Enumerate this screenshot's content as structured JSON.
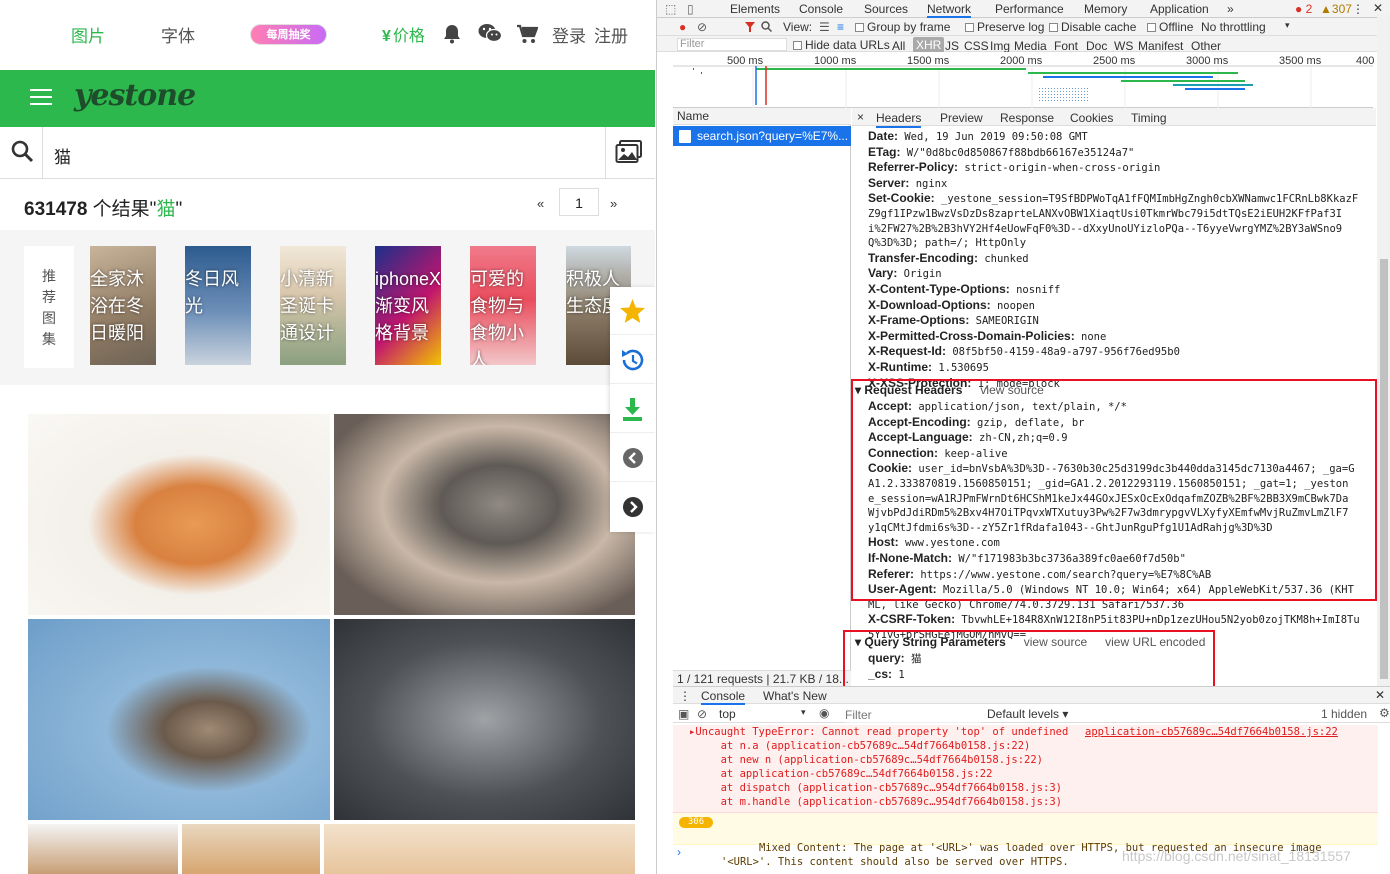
{
  "site": {
    "nav": {
      "pictures": "图片",
      "fonts": "字体",
      "weekly": "每周抽奖",
      "price": "价格",
      "login": "登录",
      "register": "注册"
    },
    "logo": "yestone",
    "search": {
      "query": "猫"
    },
    "results": {
      "count": "631478",
      "suffix": " 个结果\"",
      "keyword": "猫",
      "close": "\""
    },
    "pager": {
      "prev": "«",
      "page": "1",
      "next": "»"
    },
    "recommend": {
      "tag": [
        "推",
        "荐",
        "图",
        "集"
      ]
    },
    "cards": [
      {
        "lines": [
          "全家沐",
          "浴在冬",
          "日暖阳"
        ]
      },
      {
        "lines": [
          "冬日风",
          "光"
        ]
      },
      {
        "lines": [
          "小清新",
          "圣诞卡",
          "通设计"
        ]
      },
      {
        "lines": [
          "iphoneX",
          "渐变风",
          "格背景"
        ]
      },
      {
        "lines": [
          "可爱的",
          "食物与",
          "食物小",
          "人"
        ]
      },
      {
        "lines": [
          "积极人",
          "生态度"
        ]
      }
    ]
  },
  "devtools": {
    "tabs": [
      "Elements",
      "Console",
      "Sources",
      "Network",
      "Performance",
      "Memory",
      "Application",
      "»"
    ],
    "status": {
      "errors": "2",
      "warnings": "307"
    },
    "toolbar": {
      "view": "View:",
      "group": "Group by frame",
      "preserve": "Preserve log",
      "cache": "Disable cache",
      "offline": "Offline",
      "throttle": "No throttling"
    },
    "filter": {
      "placeholder": "Filter",
      "hide": "Hide data URLs",
      "types": [
        "All",
        "XHR",
        "JS",
        "CSS",
        "Img",
        "Media",
        "Font",
        "Doc",
        "WS",
        "Manifest",
        "Other"
      ]
    },
    "ticks": [
      "500 ms",
      "1000 ms",
      "1500 ms",
      "2000 ms",
      "2500 ms",
      "3000 ms",
      "3500 ms",
      "400"
    ],
    "name_header": "Name",
    "request": "search.json?query=%E7%...",
    "footer": "1 / 121 requests  |  21.7 KB / 18...",
    "detail_tabs": [
      "×",
      "Headers",
      "Preview",
      "Response",
      "Cookies",
      "Timing"
    ],
    "response_headers": [
      {
        "k": "Date:",
        "v": " Wed, 19 Jun 2019 09:50:08 GMT"
      },
      {
        "k": "ETag:",
        "v": " W/\"0d8bc0d850867f88bdb66167e35124a7\""
      },
      {
        "k": "Referrer-Policy:",
        "v": " strict-origin-when-cross-origin"
      },
      {
        "k": "Server:",
        "v": " nginx"
      },
      {
        "k": "Set-Cookie:",
        "v": " _yestone_session=T9SfBDPWoTqA1fFQMImbHgZngh0cbXWNamwc1FCRnLb8KkazF"
      },
      {
        "k": "",
        "v": "Z9gf1IPzw1BwzVsDzDs8zaprteLANXvOBW1XiaqtUsi0TkmrWbc79i5dtTQsE2iEUH2KFfPaf3I"
      },
      {
        "k": "",
        "v": "i%2FW27%2B%2B3hVY2Hf4eUowFqF0%3D--dXxyUnoUYizloPQa--T6yyeVwrgYMZ%2BY3aWSno9"
      },
      {
        "k": "",
        "v": "Q%3D%3D; path=/; HttpOnly"
      },
      {
        "k": "Transfer-Encoding:",
        "v": " chunked"
      },
      {
        "k": "Vary:",
        "v": " Origin"
      },
      {
        "k": "X-Content-Type-Options:",
        "v": " nosniff"
      },
      {
        "k": "X-Download-Options:",
        "v": " noopen"
      },
      {
        "k": "X-Frame-Options:",
        "v": " SAMEORIGIN"
      },
      {
        "k": "X-Permitted-Cross-Domain-Policies:",
        "v": " none"
      },
      {
        "k": "X-Request-Id:",
        "v": " 08f5bf50-4159-48a9-a797-956f76ed95b0"
      },
      {
        "k": "X-Runtime:",
        "v": " 1.530695"
      },
      {
        "k": "X-XSS-Protection:",
        "v": " 1; mode=block"
      }
    ],
    "request_headers_title": "Request Headers",
    "view_source": "view source",
    "request_headers": [
      {
        "k": "Accept:",
        "v": " application/json, text/plain, */*"
      },
      {
        "k": "Accept-Encoding:",
        "v": " gzip, deflate, br"
      },
      {
        "k": "Accept-Language:",
        "v": " zh-CN,zh;q=0.9"
      },
      {
        "k": "Connection:",
        "v": " keep-alive"
      },
      {
        "k": "Cookie:",
        "v": " user_id=bnVsbA%3D%3D--7630b30c25d3199dc3b440dda3145dc7130a4467; _ga=G"
      },
      {
        "k": "",
        "v": "A1.2.333870819.1560850151; _gid=GA1.2.2012293119.1560850151; _gat=1; _yeston"
      },
      {
        "k": "",
        "v": "e_session=wA1RJPmFWrnDt6HCShM1keJx44GOxJESxOcExOdqafmZOZB%2BF%2BB3X9mCBwk7Da"
      },
      {
        "k": "",
        "v": "WjvbPdJdiRDm5%2Bxv4H7OiTPqvxWTXutuy3Pw%2F7w3dmrypgvVLXyfyXEmfwMvjRuZmvLmZlF7"
      },
      {
        "k": "",
        "v": "y1qCMtJfdmi6s%3D--zY5Zr1fRdafa1043--GhtJunRguPfg1U1AdRahjg%3D%3D"
      },
      {
        "k": "Host:",
        "v": " www.yestone.com"
      },
      {
        "k": "If-None-Match:",
        "v": " W/\"f171983b3bc3736a389fc0ae60f7d50b\""
      },
      {
        "k": "Referer:",
        "v": " https://www.yestone.com/search?query=%E7%8C%AB"
      },
      {
        "k": "User-Agent:",
        "v": " Mozilla/5.0 (Windows NT 10.0; Win64; x64) AppleWebKit/537.36 (KHT"
      },
      {
        "k": "",
        "v": "ML, like Gecko) Chrome/74.0.3729.131 Safari/537.36"
      },
      {
        "k": "X-CSRF-Token:",
        "v": " TbvwhLE+184R8XnW12I8nP5it83PU+nDp1zezUHou5N2yob0zojTKM8h+ImI8Tu"
      },
      {
        "k": "",
        "v": "5Y1vG+prSHGEejMGOM/nMvQ=="
      }
    ],
    "query_title": "Query String Parameters",
    "view_url": "view URL encoded",
    "query_params": [
      {
        "k": "query:",
        "v": " 猫"
      },
      {
        "k": "_cs:",
        "v": " 1"
      }
    ],
    "console": {
      "tabs": [
        "Console",
        "What's New"
      ],
      "context": "top",
      "filter": "Filter",
      "levels": "Default levels ▾",
      "hidden": "1 hidden",
      "error_lines": [
        "Uncaught TypeError: Cannot read property 'top' of undefined",
        "    at n.a (application-cb57689c…54df7664b0158.js:22)",
        "    at new n (application-cb57689c…54df7664b0158.js:22)",
        "    at application-cb57689c…54df7664b0158.js:22",
        "    at dispatch (application-cb57689c…954df7664b0158.js:3)",
        "    at m.handle (application-cb57689c…954df7664b0158.js:3)"
      ],
      "error_link": "application-cb57689c…54df7664b0158.js:22",
      "warn_count": "306",
      "warn_lines": [
        "Mixed Content: The page at '<URL>' was loaded over HTTPS, but requested an insecure image",
        "'<URL>'. This content should also be served over HTTPS."
      ]
    },
    "watermark": "https://blog.csdn.net/sinat_18131557"
  }
}
